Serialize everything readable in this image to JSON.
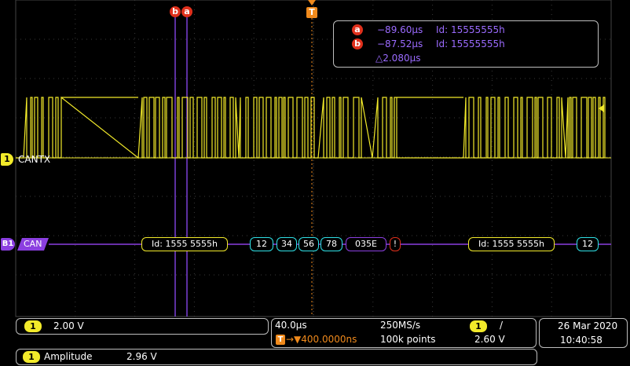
{
  "colors": {
    "ch1": "#f2ea2a",
    "bus": "#8b3fe0",
    "cursor": "#7a3fd6",
    "trigger": "#f08a1c",
    "cyan": "#2fe0e6",
    "red": "#e0301c",
    "grid": "#3a3a3a"
  },
  "markers": {
    "cursor_b": "b",
    "cursor_a": "a",
    "trigger": "T"
  },
  "readout": {
    "a_label": "a",
    "a_time": "−89.60µs",
    "a_id": "Id: 15555555h",
    "b_label": "b",
    "b_time": "−87.52µs",
    "b_id": "Id: 15555555h",
    "delta": "△2.080µs"
  },
  "channel1": {
    "number": "1",
    "label": "CANTX"
  },
  "bus": {
    "number": "B1",
    "label": "CAN",
    "packets": [
      {
        "text": "Id: 1555 5555h",
        "color": "#f2ea2a"
      },
      {
        "text": "12",
        "color": "#2fe0e6"
      },
      {
        "text": "34",
        "color": "#2fe0e6"
      },
      {
        "text": "56",
        "color": "#2fe0e6"
      },
      {
        "text": "78",
        "color": "#2fe0e6"
      },
      {
        "text": "035E",
        "color": "#8b3fe0"
      },
      {
        "text": "!",
        "color": "#e0301c"
      },
      {
        "text": "Id: 1555 5555h",
        "color": "#f2ea2a"
      },
      {
        "text": "12",
        "color": "#2fe0e6"
      }
    ]
  },
  "status": {
    "ch1_num": "1",
    "ch1_scale": "2.00 V",
    "timebase": "40.0µs",
    "sample_rate": "250MS/s",
    "trig_ch": "1",
    "trig_slope": "/",
    "trig_pos_label": "T",
    "trig_pos": "→▼400.0000ns",
    "record": "100k points",
    "trig_level": "2.60 V",
    "date": "26 Mar  2020",
    "time": "10:40:58",
    "meas_ch": "1",
    "meas_name": "Amplitude",
    "meas_value": "2.96 V"
  }
}
